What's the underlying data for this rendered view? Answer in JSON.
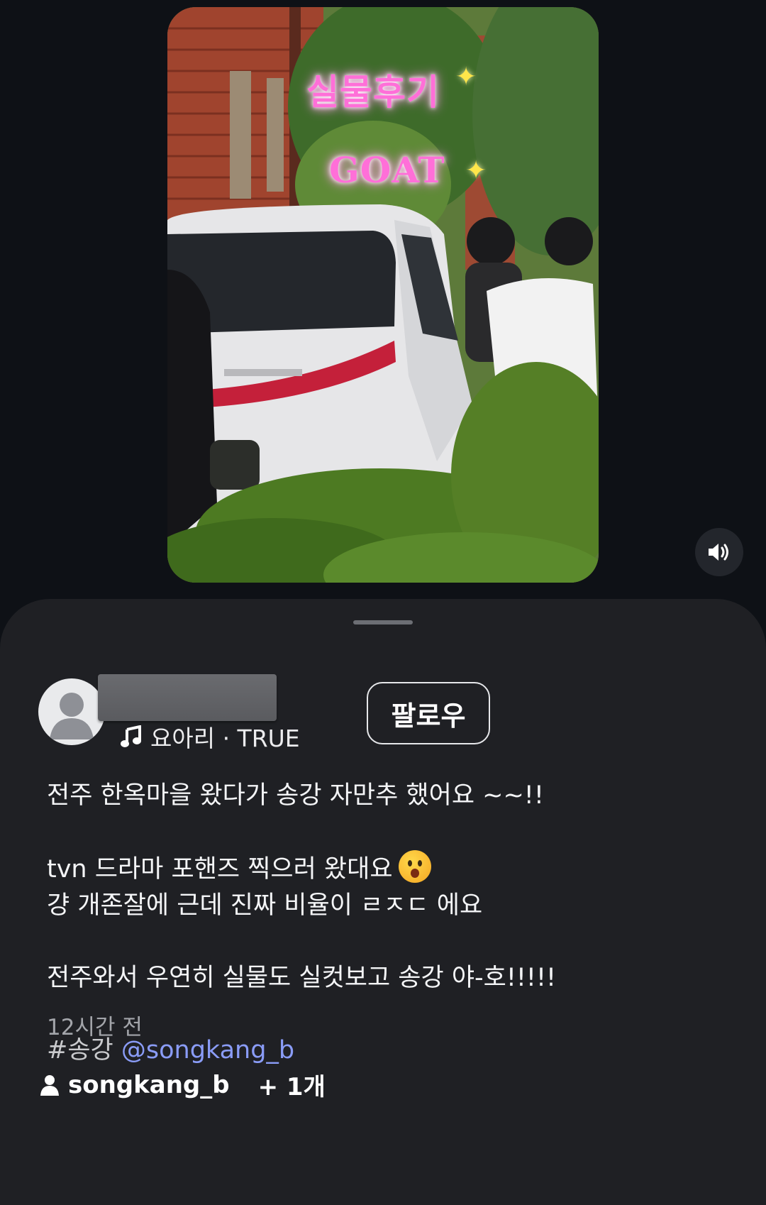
{
  "video": {
    "overlay_line_1": "실물후기",
    "overlay_line_2": "GOAT",
    "sparkle_glyph": "✦",
    "sound_icon": "speaker-volume-icon"
  },
  "post": {
    "author_name_redacted": true,
    "music_icon": "music-note-icon",
    "music": "요아리 · TRUE",
    "follow_label": "팔로우",
    "caption": {
      "line_1": "전주 한옥마을 왔다가 송강 자만추 했어요 ~~!!",
      "line_2": "tvn 드라마 포핸즈 찍으러 왔대요",
      "line_2_emoji": "hushed-face-emoji",
      "line_3": "걍 개존잘에 근데 진짜 비율이 ㄹㅈㄷ 에요",
      "line_4": "전주와서 우연히 실물도 실컷보고 송강 야-호!!!!!",
      "hashtag": "#송강",
      "mention": "@songkang_b"
    },
    "timestamp": "12시간 전",
    "tagged_user_icon": "person-icon",
    "tagged_user": "songkang_b",
    "tagged_more": "+ 1개"
  },
  "colors": {
    "background": "#0e1116",
    "sheet": "#1f2024",
    "mention": "#8a9cf7",
    "overlay_text": "#ff6fd8"
  }
}
